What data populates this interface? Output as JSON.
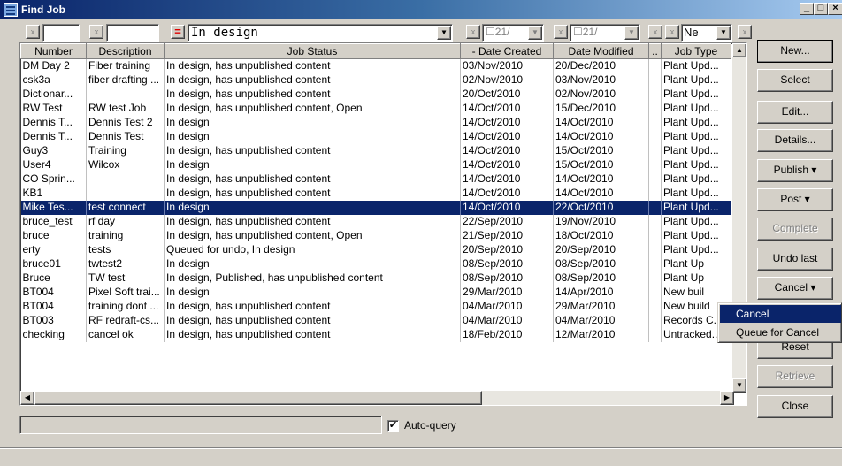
{
  "window": {
    "title": "Find Job",
    "min_label": "_",
    "max_label": "□",
    "close_label": "×"
  },
  "filter": {
    "x_label": "x",
    "eq_label": "=",
    "status_value": "In design",
    "date1_value": "21/",
    "date2_value": "21/",
    "type_value": "Ne"
  },
  "columns": [
    "Number",
    "Description",
    "Job Status",
    "- Date Created",
    "Date Modified",
    "..",
    "Job Type"
  ],
  "rows": [
    [
      "DM Day 2",
      "Fiber training",
      "In design, has unpublished content",
      "03/Nov/2010",
      "20/Dec/2010",
      "",
      "Plant Upd..."
    ],
    [
      "csk3a",
      "fiber drafting ...",
      "In design, has unpublished content",
      "02/Nov/2010",
      "03/Nov/2010",
      "",
      "Plant Upd..."
    ],
    [
      "Dictionar...",
      "",
      "In design, has unpublished content",
      "20/Oct/2010",
      "02/Nov/2010",
      "",
      "Plant Upd..."
    ],
    [
      "RW Test",
      "RW test Job",
      "In design, has unpublished content, Open",
      "14/Oct/2010",
      "15/Dec/2010",
      "",
      "Plant Upd..."
    ],
    [
      "Dennis T...",
      "Dennis Test 2",
      "In design",
      "14/Oct/2010",
      "14/Oct/2010",
      "",
      "Plant Upd..."
    ],
    [
      "Dennis T...",
      "Dennis Test",
      "In design",
      "14/Oct/2010",
      "14/Oct/2010",
      "",
      "Plant Upd..."
    ],
    [
      "Guy3",
      "Training",
      "In design, has unpublished content",
      "14/Oct/2010",
      "15/Oct/2010",
      "",
      "Plant Upd..."
    ],
    [
      "User4",
      "Wilcox",
      "In design",
      "14/Oct/2010",
      "15/Oct/2010",
      "",
      "Plant Upd..."
    ],
    [
      "CO Sprin...",
      "",
      "In design, has unpublished content",
      "14/Oct/2010",
      "14/Oct/2010",
      "",
      "Plant Upd..."
    ],
    [
      "KB1",
      "",
      "In design, has unpublished content",
      "14/Oct/2010",
      "14/Oct/2010",
      "",
      "Plant Upd..."
    ],
    [
      "Mike Tes...",
      "test connect",
      "In design",
      "14/Oct/2010",
      "22/Oct/2010",
      "",
      "Plant Upd..."
    ],
    [
      "bruce_test",
      "rf day",
      "In design, has unpublished content",
      "22/Sep/2010",
      "19/Nov/2010",
      "",
      "Plant Upd..."
    ],
    [
      "bruce",
      "training",
      "In design, has unpublished content, Open",
      "21/Sep/2010",
      "18/Oct/2010",
      "",
      "Plant Upd..."
    ],
    [
      "erty",
      "tests",
      "Queued for undo, In design",
      "20/Sep/2010",
      "20/Sep/2010",
      "",
      "Plant Upd..."
    ],
    [
      "bruce01",
      "twtest2",
      "In design",
      "08/Sep/2010",
      "08/Sep/2010",
      "",
      "Plant Up"
    ],
    [
      "Bruce",
      "TW test",
      "In design, Published, has unpublished content",
      "08/Sep/2010",
      "08/Sep/2010",
      "",
      "Plant Up"
    ],
    [
      "BT004",
      "Pixel Soft trai...",
      "In design",
      "29/Mar/2010",
      "14/Apr/2010",
      "",
      "New buil"
    ],
    [
      "BT004",
      "training dont ...",
      "In design, has unpublished content",
      "04/Mar/2010",
      "29/Mar/2010",
      "",
      "New build"
    ],
    [
      "BT003",
      "RF redraft-cs...",
      "In design, has unpublished content",
      "04/Mar/2010",
      "04/Mar/2010",
      "",
      "Records C..."
    ],
    [
      "checking",
      "cancel ok",
      "In design, has unpublished content",
      "18/Feb/2010",
      "12/Mar/2010",
      "",
      "Untracked..."
    ]
  ],
  "selected_row_index": 10,
  "buttons": {
    "new": "New...",
    "select": "Select",
    "edit": "Edit...",
    "details": "Details...",
    "publish": "Publish ▾",
    "post": "Post ▾",
    "complete": "Complete",
    "undo_last": "Undo last",
    "cancel": "Cancel ▾",
    "reset": "Reset",
    "retrieve": "Retrieve",
    "close": "Close"
  },
  "cancel_menu": [
    "Cancel",
    "Queue for Cancel"
  ],
  "auto_query": {
    "label": "Auto-query",
    "checked": true,
    "check_glyph": "✔"
  },
  "colors": {
    "selection": "#0a246a",
    "face": "#d4d0c8",
    "title_start": "#0a246a",
    "title_end": "#a6caf0"
  }
}
